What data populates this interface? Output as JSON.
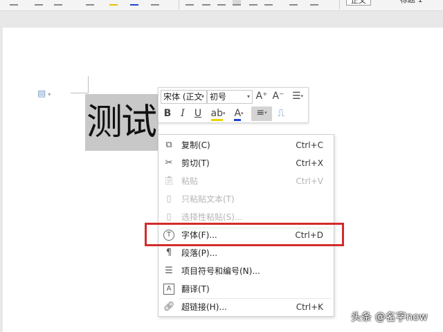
{
  "ribbon": {
    "style_normal": "正文",
    "style_heading1": "标题 1"
  },
  "mini_toolbar": {
    "font_name": "宋体 (正文",
    "font_size": "初号",
    "grow_font": "A⁺",
    "shrink_font": "A⁻",
    "bold": "B",
    "italic": "I",
    "underline": "U",
    "highlight": "ab",
    "font_color": "A"
  },
  "context_menu": {
    "items": [
      {
        "label": "复制(C)",
        "shortcut": "Ctrl+C",
        "icon": "copy-icon"
      },
      {
        "label": "剪切(T)",
        "shortcut": "Ctrl+X",
        "icon": "scissors-icon"
      },
      {
        "label": "粘贴",
        "shortcut": "Ctrl+V",
        "icon": "paste-icon"
      },
      {
        "label": "只粘贴文本(T)",
        "shortcut": "",
        "icon": "paste-text-icon"
      },
      {
        "label": "选择性粘贴(S)...",
        "shortcut": "",
        "icon": "paste-special-icon"
      },
      {
        "label": "字体(F)...",
        "shortcut": "Ctrl+D",
        "icon": "font-icon"
      },
      {
        "label": "段落(P)...",
        "shortcut": "",
        "icon": "paragraph-icon"
      },
      {
        "label": "项目符号和编号(N)...",
        "shortcut": "",
        "icon": "bullets-icon"
      },
      {
        "label": "翻译(T)",
        "shortcut": "",
        "icon": "translate-icon"
      },
      {
        "label": "超链接(H)...",
        "shortcut": "Ctrl+K",
        "icon": "link-icon"
      }
    ]
  },
  "document": {
    "selected_text": "测试"
  },
  "watermark": "头条 @名字now",
  "colors": {
    "highlight_border": "#d42a2a",
    "disabled_text": "#b5b5b5",
    "selection": "#c8c8c8"
  }
}
